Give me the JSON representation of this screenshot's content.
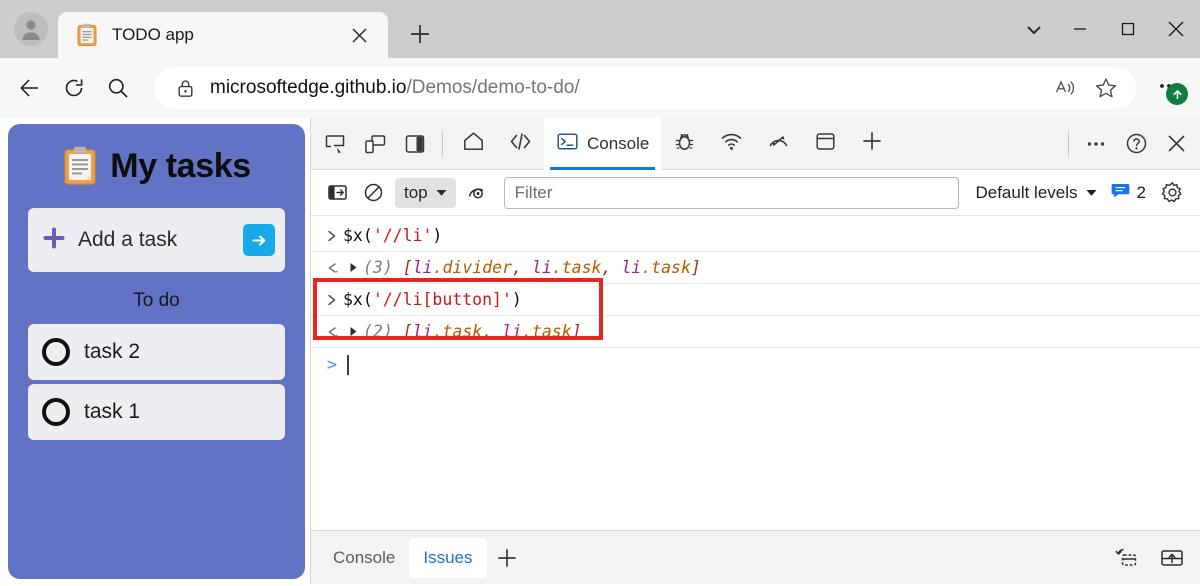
{
  "browser": {
    "profile_icon": "person-avatar-icon",
    "tab": {
      "favicon": "clipboard-icon",
      "title": "TODO app",
      "close_icon": "close-icon"
    },
    "new_tab_icon": "plus-icon",
    "tab_search_icon": "chevron-down-icon",
    "window_controls": {
      "minimize_icon": "minimize-icon",
      "maximize_icon": "maximize-icon",
      "close_icon": "close-icon"
    },
    "toolbar": {
      "back_icon": "arrow-left-icon",
      "reload_icon": "reload-icon",
      "search_icon": "search-icon",
      "lock_icon": "lock-icon",
      "url_host": "microsoftedge.github.io",
      "url_path": "/Demos/demo-to-do/",
      "read_aloud_icon": "read-aloud-icon",
      "favorite_icon": "star-icon",
      "settings_icon": "ellipsis-icon",
      "update_badge_icon": "arrow-up-badge-icon"
    }
  },
  "todo_app": {
    "header_icon": "clipboard-icon",
    "header_title": "My tasks",
    "add_task": {
      "plus_icon": "plus-icon",
      "label": "Add a task",
      "submit_icon": "arrow-right-icon"
    },
    "section_title": "To do",
    "tasks": [
      {
        "label": "task 2",
        "checkbox_icon": "circle-unchecked-icon"
      },
      {
        "label": "task 1",
        "checkbox_icon": "circle-unchecked-icon"
      }
    ],
    "colors": {
      "panel_bg": "#6272c4",
      "card_bg": "#eceef2",
      "submit_btn": "#17a9e8",
      "plus": "#6b5bbd"
    }
  },
  "devtools": {
    "toolbar_icons": [
      "inspect-element-icon",
      "device-emulation-icon",
      "panel-layout-icon"
    ],
    "tabs": [
      {
        "label": "",
        "icon": "home-icon",
        "active": false
      },
      {
        "label": "",
        "icon": "elements-code-icon",
        "active": false
      },
      {
        "label": "Console",
        "icon": "console-terminal-icon",
        "active": true
      },
      {
        "label": "",
        "icon": "debugger-bug-icon",
        "active": false
      },
      {
        "label": "",
        "icon": "network-wifi-icon",
        "active": false
      },
      {
        "label": "",
        "icon": "performance-gauge-icon",
        "active": false
      },
      {
        "label": "",
        "icon": "application-box-icon",
        "active": false
      },
      {
        "label": "",
        "icon": "plus-icon",
        "active": false
      }
    ],
    "right_icons": [
      "ellipsis-icon",
      "help-question-icon",
      "close-icon"
    ],
    "filterbar": {
      "sidebar_toggle_icon": "console-sidebar-icon",
      "clear_console_icon": "clear-console-icon",
      "context_label": "top",
      "context_chevron_icon": "chevron-down-icon",
      "live_expression_icon": "eye-icon",
      "filter_placeholder": "Filter",
      "filter_value": "",
      "levels_label": "Default levels",
      "levels_chevron_icon": "chevron-down-icon",
      "message_icon": "message-bubble-icon",
      "message_count": "2",
      "settings_icon": "gear-icon"
    },
    "console_entries": [
      {
        "type": "command",
        "gutter_icon": "chevron-right-icon",
        "code_prefix": "$x(",
        "code_string": "'//li'",
        "code_suffix": ")",
        "highlighted": false
      },
      {
        "type": "result",
        "gutter_icon": "return-arrow-icon",
        "disclosure_icon": "triangle-right-icon",
        "count": "(3)",
        "open_bracket": "[",
        "items": [
          {
            "tag": "li",
            "cls": ".divider"
          },
          {
            "tag": "li",
            "cls": ".task"
          },
          {
            "tag": "li",
            "cls": ".task"
          }
        ],
        "close_bracket": "]",
        "highlighted": false
      },
      {
        "type": "command",
        "gutter_icon": "chevron-right-icon",
        "code_prefix": "$x(",
        "code_string": "'//li[button]'",
        "code_suffix": ")",
        "highlighted": true
      },
      {
        "type": "result",
        "gutter_icon": "return-arrow-icon",
        "disclosure_icon": "triangle-right-icon",
        "count": "(2)",
        "open_bracket": "[",
        "items": [
          {
            "tag": "li",
            "cls": ".task"
          },
          {
            "tag": "li",
            "cls": ".task"
          }
        ],
        "close_bracket": "]",
        "highlighted": true
      }
    ],
    "prompt": {
      "chevron": ">",
      "value": ""
    },
    "highlight_color": "#e8251e",
    "drawer": {
      "tabs": [
        {
          "label": "Console",
          "active": false
        },
        {
          "label": "Issues",
          "active": true
        }
      ],
      "add_icon": "plus-icon",
      "right_icons": [
        "restore-drawer-icon",
        "dock-to-top-icon"
      ]
    }
  }
}
